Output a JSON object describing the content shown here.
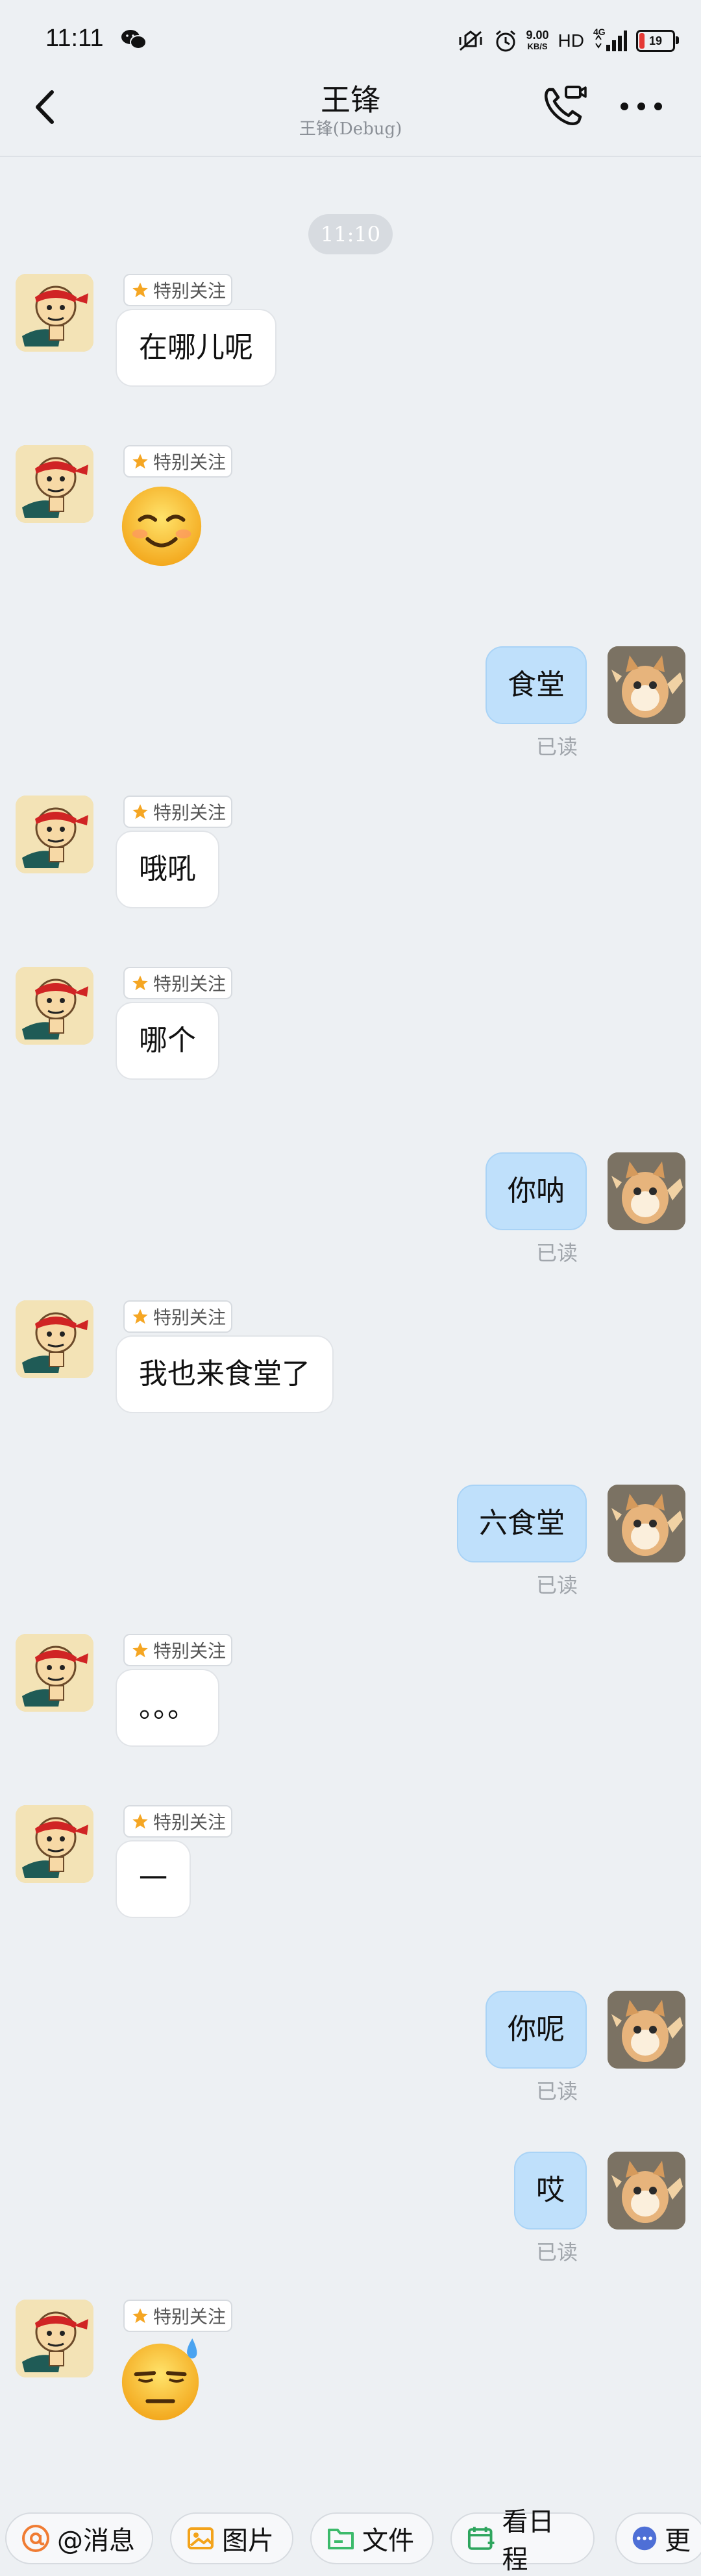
{
  "status_bar": {
    "time": "11:11",
    "net_speed_value": "9.00",
    "net_speed_unit": "KB/S",
    "hd": "HD",
    "signal": "4G",
    "battery": "19"
  },
  "header": {
    "title": "王锋",
    "subtitle": "王锋(Debug)"
  },
  "chat": {
    "timestamp": "11:10",
    "tag_label": "特别关注",
    "read_label": "已读",
    "messages": [
      {
        "text": "在哪儿呢"
      },
      {
        "emoji": "smiling-face-emoji"
      },
      {
        "text": "食堂"
      },
      {
        "text": "哦吼"
      },
      {
        "text": "哪个"
      },
      {
        "text": "你呐"
      },
      {
        "text": "我也来食堂了"
      },
      {
        "text": "六食堂"
      },
      {
        "text": "。。。"
      },
      {
        "text": "一"
      },
      {
        "text": "你呢"
      },
      {
        "text": "哎"
      },
      {
        "emoji": "unamused-sweat-emoji"
      }
    ]
  },
  "toolbar": {
    "at_label": "@消息",
    "image_label": "图片",
    "file_label": "文件",
    "schedule_label": "看日程",
    "more_label": "更"
  },
  "colors": {
    "background": "#edf0f3",
    "outgoing_bubble": "#bfe0fb",
    "incoming_bubble": "#ffffff",
    "star": "#f5a623",
    "at_icon": "#f07c33",
    "image_icon": "#f3a31b",
    "file_icon": "#3cba6b",
    "schedule_icon": "#2ea55e",
    "more_icon": "#4e6fd6"
  }
}
